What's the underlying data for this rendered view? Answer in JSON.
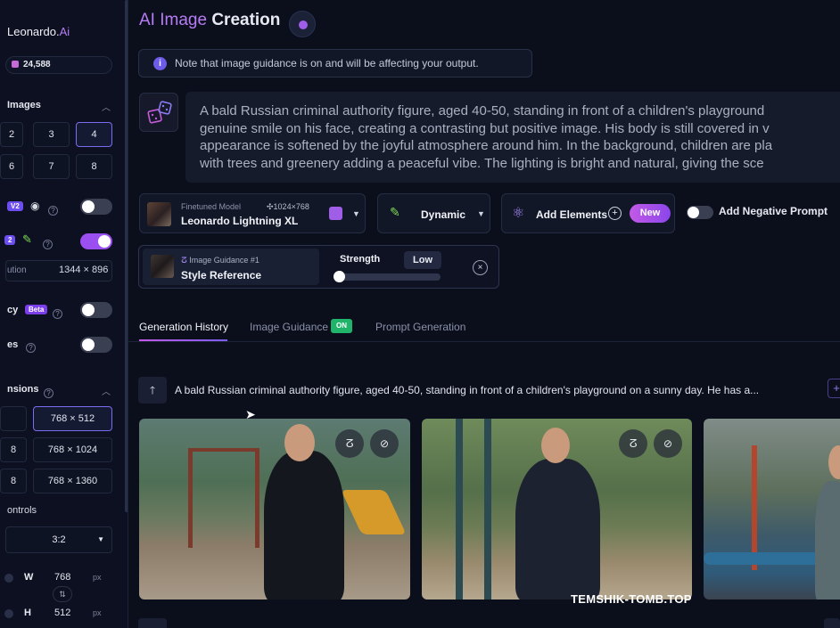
{
  "sidebar": {
    "logo_text": "Leonardo.",
    "logo_ai": "Ai",
    "tokens": "24,588",
    "images_label": "Images",
    "image_counts": [
      "2",
      "3",
      "4",
      "6",
      "7",
      "8"
    ],
    "selected_count": "4",
    "v2_pill": "V2",
    "v2_pill2": "2",
    "resolution_label": "ution",
    "resolution_value": "1344 × 896",
    "privacy_label": "cy",
    "beta_pill": "Beta",
    "tiles_label": "es",
    "dimensions_label": "nsions",
    "dimension_options": [
      {
        "left": "",
        "right": "768 × 512"
      },
      {
        "left": "8",
        "right": "768 × 1024"
      },
      {
        "left": "8",
        "right": "768 × 1360"
      }
    ],
    "controls_label": "ontrols",
    "aspect_ratio": "3:2",
    "w_label": "W",
    "w_value": "768",
    "h_label": "H",
    "h_value": "512",
    "px_unit": "px",
    "toggles": {
      "v2_on": false,
      "pl2_on": true,
      "privacy_on": false,
      "tiles_on": false
    }
  },
  "main": {
    "title_grad": "AI Image",
    "title_plain": "Creation",
    "notice": "Note that image guidance is on and will be affecting your output.",
    "prompt": "A bald Russian criminal authority figure, aged 40-50, standing in front of a children's playground\ngenuine smile on his face, creating a contrasting but positive image. His body is still covered in v\nappearance is softened by the joyful atmosphere around him. In the background, children are pla\nwith trees and greenery adding a peaceful vibe. The lighting is bright and natural, giving the sce",
    "model": {
      "caption": "Finetuned Model",
      "size": "1024×768",
      "name": "Leonardo Lightning XL"
    },
    "style": "Dynamic",
    "add_elements": "Add Elements",
    "new_badge": "New",
    "negative_prompt": "Add Negative Prompt",
    "guidance": {
      "caption": "Image Guidance #1",
      "type": "Style Reference",
      "strength_label": "Strength",
      "strength_value": "Low",
      "strength_level": 0
    }
  },
  "tabs": {
    "history": "Generation History",
    "guidance": "Image Guidance",
    "guidance_badge": "ON",
    "prompt_gen": "Prompt Generation"
  },
  "history": {
    "prompt": "A bald Russian criminal authority figure, aged 40-50, standing in front of a children's playground on a sunny day. He has a..."
  },
  "watermark": "TEMSHIK-TOMB.TOP",
  "colors": {
    "accent": "#9b4ff0",
    "brand_gradient_start": "#c25ae6",
    "on_badge": "#1fb46a",
    "background": "#0b0f1c"
  },
  "icons": [
    "dice-icon",
    "info-icon",
    "chevron-up-icon",
    "help-icon",
    "sparkle-icon",
    "plus-circle-icon",
    "atom-icon",
    "chevron-down-icon",
    "close-icon",
    "arrow-up-icon",
    "remix-icon",
    "hide-icon",
    "swap-icon"
  ]
}
